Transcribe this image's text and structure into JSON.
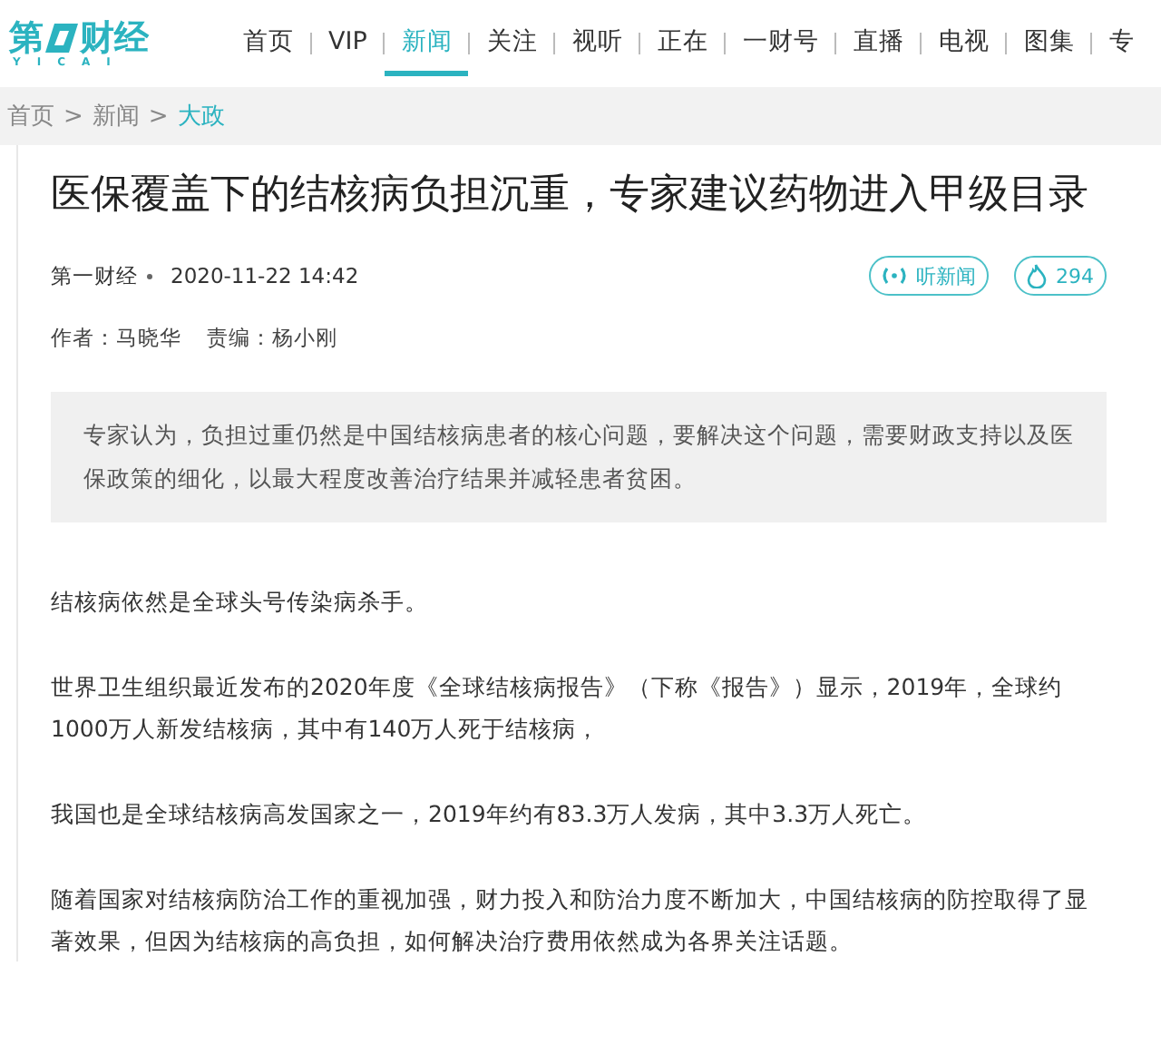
{
  "logo": {
    "left": "第",
    "right": "财经",
    "subtitle": "YICAI"
  },
  "nav": [
    {
      "label": "首页",
      "selected": false
    },
    {
      "label": "VIP",
      "selected": false
    },
    {
      "label": "新闻",
      "selected": true
    },
    {
      "label": "关注",
      "selected": false
    },
    {
      "label": "视听",
      "selected": false
    },
    {
      "label": "正在",
      "selected": false
    },
    {
      "label": "一财号",
      "selected": false
    },
    {
      "label": "直播",
      "selected": false
    },
    {
      "label": "电视",
      "selected": false
    },
    {
      "label": "图集",
      "selected": false
    },
    {
      "label": "专",
      "selected": false
    }
  ],
  "breadcrumb": [
    {
      "label": "首页",
      "selected": false
    },
    {
      "label": "新闻",
      "selected": false
    },
    {
      "label": "大政",
      "selected": true
    }
  ],
  "breadcrumb_separator": ">",
  "article": {
    "title": "医保覆盖下的结核病负担沉重，专家建议药物进入甲级目录",
    "source": "第一财经",
    "date": "2020-11-22 14:42",
    "listen_button": "听新闻",
    "hot_count": "294",
    "author_label": "作者：",
    "author": "马晓华",
    "editor_label": "责编：",
    "editor": "杨小刚",
    "summary": "专家认为，负担过重仍然是中国结核病患者的核心问题，要解决这个问题，需要财政支持以及医保政策的细化，以最大程度改善治疗结果并减轻患者贫困。",
    "paragraphs": [
      "结核病依然是全球头号传染病杀手。",
      "世界卫生组织最近发布的2020年度《全球结核病报告》（下称《报告》）显示，2019年，全球约1000万人新发结核病，其中有140万人死于结核病，",
      "我国也是全球结核病高发国家之一，2019年约有83.3万人发病，其中3.3万人死亡。",
      "随着国家对结核病防治工作的重视加强，财力投入和防治力度不断加大，中国结核病的防控取得了显著效果，但因为结核病的高负担，如何解决治疗费用依然成为各界关注话题。"
    ]
  }
}
